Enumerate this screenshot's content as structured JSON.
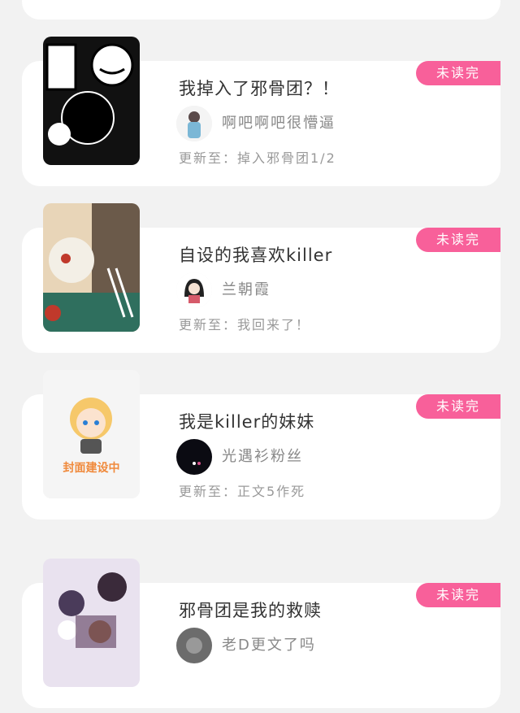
{
  "books": [
    {
      "title": "我掉入了邪骨团？！",
      "author": "啊吧啊吧很懵逼",
      "update": "更新至：掉入邪骨团1/2",
      "badge": "未读完",
      "cover": "comic-cover"
    },
    {
      "title": "自设的我喜欢killer",
      "author": "兰朝霞",
      "update": "更新至：我回来了！",
      "badge": "未读完",
      "cover": "comic-cover"
    },
    {
      "title": "我是killer的妹妹",
      "author": "光遇衫粉丝",
      "update": "更新至：正文5作死",
      "badge": "未读完",
      "cover": "placeholder",
      "cover_text": "封面建设中"
    },
    {
      "title": "邪骨团是我的救赎",
      "author": "老D更文了吗",
      "update": "",
      "badge": "未读完",
      "cover": "comic-cover"
    }
  ],
  "colors": {
    "badge": "#f8609a",
    "background": "#f2f2f2",
    "card": "#ffffff"
  }
}
